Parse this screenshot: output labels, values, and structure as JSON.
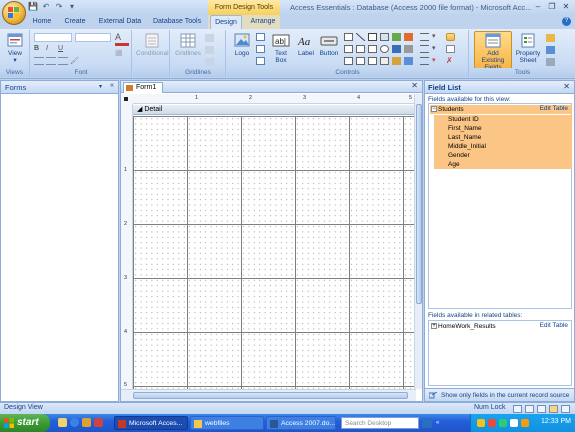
{
  "titlebar": {
    "contextual_title": "Form Design Tools",
    "window_title": "Access Essentials : Database (Access 2000 file format) - Microsoft Acc...",
    "minimize": "–",
    "maximize": "❐",
    "close": "✕"
  },
  "ribbon": {
    "tabs": [
      "Home",
      "Create",
      "External Data",
      "Database Tools",
      "Design",
      "Arrange"
    ],
    "active_tab": "Design",
    "groups": {
      "views": {
        "label": "Views",
        "view_button": "View"
      },
      "font": {
        "label": "Font"
      },
      "conditional": {
        "label": "Conditional"
      },
      "gridlines": {
        "label": "Gridlines",
        "button": "Gridlines"
      },
      "controls": {
        "label": "Controls",
        "logo": "Logo",
        "textbox_line1": "Text",
        "textbox_line2": "Box",
        "label_button": "Label",
        "button_button": "Button"
      },
      "tools": {
        "label": "Tools",
        "add_existing_line1": "Add Existing",
        "add_existing_line2": "Fields",
        "property_line1": "Property",
        "property_line2": "Sheet"
      }
    }
  },
  "navpane": {
    "title": "Forms",
    "dropdown_glyph": "▾",
    "collapse_glyph": "«"
  },
  "document": {
    "tab_label": "Form1",
    "close_glyph": "✕",
    "section_label": "Detail",
    "section_glyph": "◢",
    "ruler_top_numbers": [
      "1",
      "2",
      "3",
      "4",
      "5"
    ],
    "ruler_left_numbers": [
      "1",
      "2",
      "3",
      "4",
      "5"
    ]
  },
  "fieldlist": {
    "title": "Field List",
    "close_glyph": "✕",
    "available_label": "Fields available for this view:",
    "edit_table": "Edit Table",
    "table_name": "Students",
    "fields": [
      "Student ID",
      "First_Name",
      "Last_Name",
      "Middle_Initial",
      "Gender",
      "Age"
    ],
    "related_label": "Fields available in related tables:",
    "related_table": "HomeWork_Results",
    "expand_glyph": "+",
    "collapse_glyph": "−",
    "footer": "Show only fields in the current record source"
  },
  "statusbar": {
    "left": "Design View",
    "right": "Num Lock"
  },
  "taskbar": {
    "start": "start",
    "items": [
      "Microsoft Acces...",
      "webfiles",
      "Access 2007.do..."
    ],
    "search_placeholder": "Search Desktop",
    "clock": "12:33 PM"
  },
  "colors": {
    "selection": "#fbc585",
    "ribbon_text": "#15428b",
    "taskbar_blue": "#245edb",
    "start_green": "#3a9b33"
  },
  "icons": [
    "office-button-icon",
    "save-icon",
    "undo-icon",
    "redo-icon",
    "help-icon",
    "view-icon",
    "logo-icon",
    "textbox-icon",
    "label-icon",
    "button-icon",
    "add-existing-fields-icon",
    "property-sheet-icon",
    "form-icon",
    "windows-flag-icon"
  ]
}
